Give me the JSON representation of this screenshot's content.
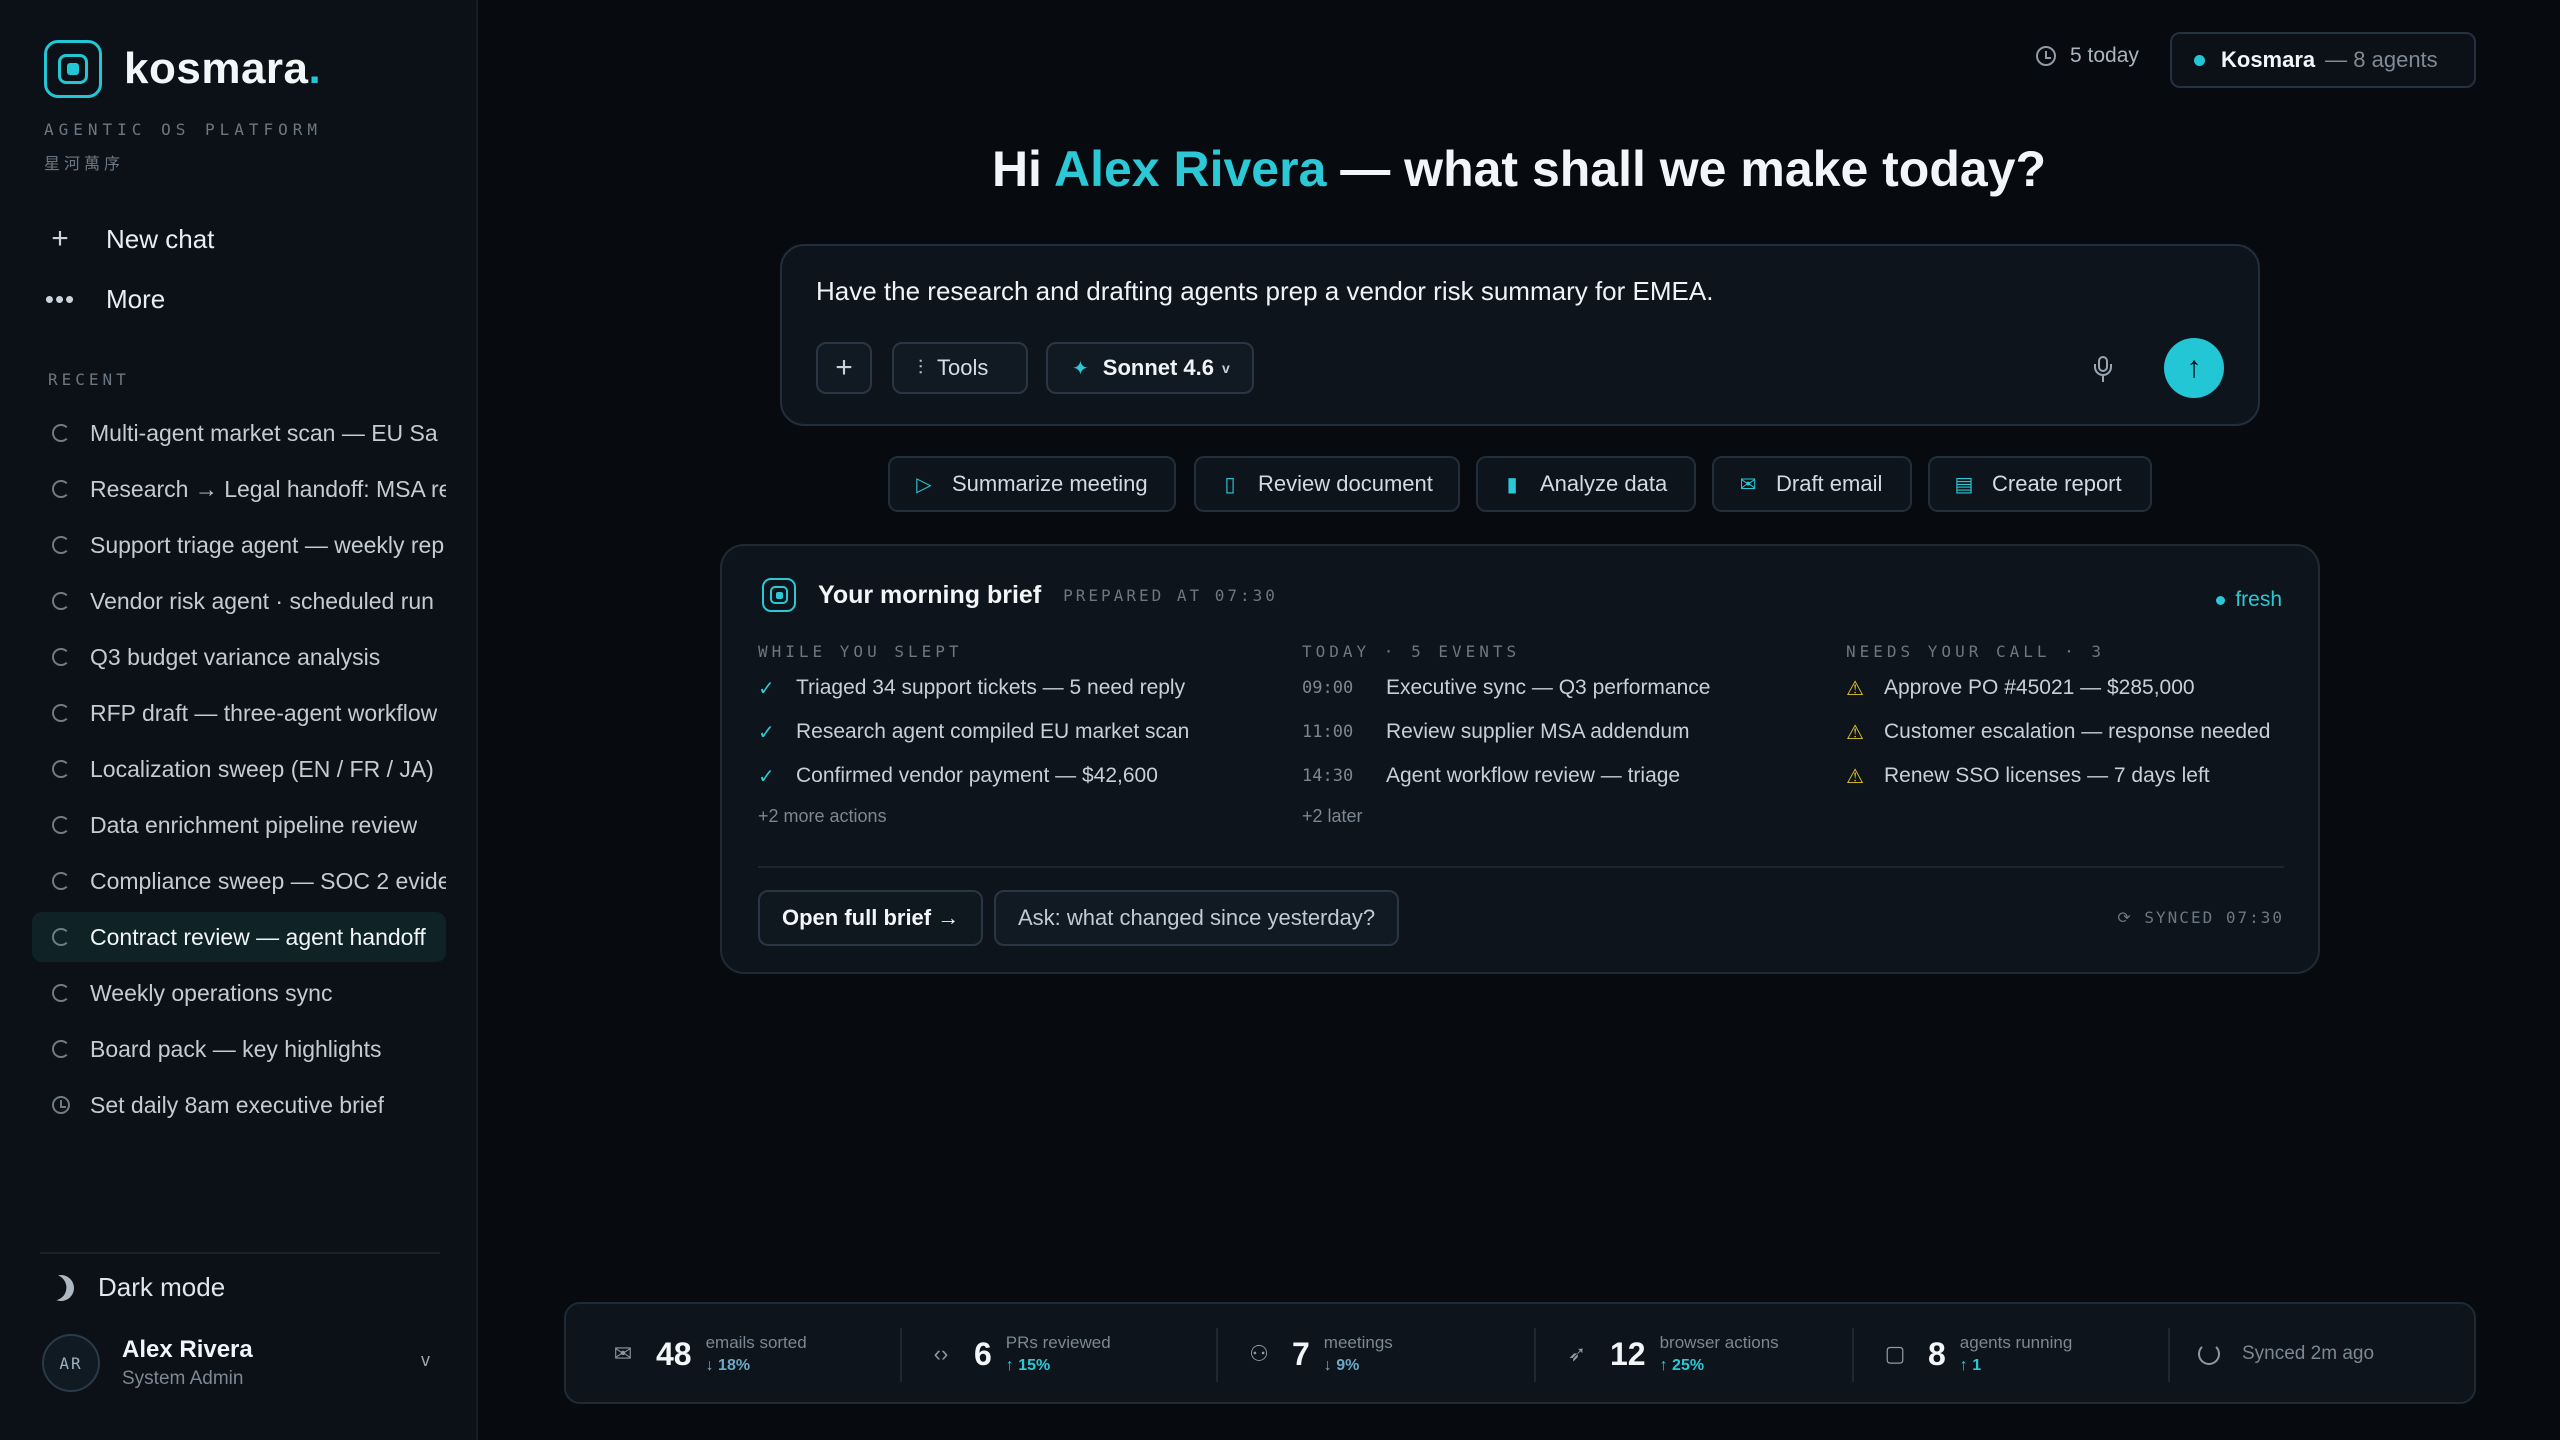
{
  "sidebar": {
    "logo_text": "kosmara",
    "logo_accent": ".",
    "tagline": "AGENTIC OS PLATFORM",
    "tagline_cjk": "星河萬序",
    "new_chat": "New chat",
    "more": "More",
    "recent_label": "RECENT",
    "recent": [
      "Multi-agent market scan — EU Sa",
      "Research → Legal handoff: MSA re",
      "Support triage agent — weekly rep",
      "Vendor risk agent · scheduled run",
      "Q3 budget variance analysis",
      "RFP draft — three-agent workflow",
      "Localization sweep (EN / FR / JA)",
      "Data enrichment pipeline review",
      "Compliance sweep — SOC 2 evide",
      "Contract review — agent handoff",
      "Weekly operations sync",
      "Board pack — key highlights",
      "Set daily 8am executive brief"
    ],
    "active_index": 9,
    "dark_mode": "Dark mode",
    "user": {
      "initials": "AR",
      "name": "Alex Rivera",
      "role": "System Admin",
      "caret": "v"
    }
  },
  "header": {
    "today": "5 today",
    "workspace": "Kosmara",
    "agents": "— 8 agents"
  },
  "greeting": {
    "hi": "Hi",
    "name": "Alex Rivera",
    "rest": "— what shall we make today?"
  },
  "composer": {
    "prompt": "Have the research and drafting agents prep a vendor risk summary for EMEA.",
    "plus": "+",
    "tools": "Tools",
    "model": "Sonnet 4.6",
    "model_caret": "v"
  },
  "quick_actions": [
    {
      "label": "Summarize meeting",
      "icon": "play-icon"
    },
    {
      "label": "Review document",
      "icon": "document-icon"
    },
    {
      "label": "Analyze data",
      "icon": "chart-icon"
    },
    {
      "label": "Draft email",
      "icon": "mail-icon"
    },
    {
      "label": "Create report",
      "icon": "report-icon"
    }
  ],
  "brief": {
    "title": "Your morning brief",
    "prepared": "PREPARED AT 07:30",
    "fresh": "fresh",
    "while_you_slept": {
      "heading": "WHILE YOU SLEPT",
      "items": [
        "Triaged 34 support tickets — 5 need reply",
        "Research agent compiled EU market scan",
        "Confirmed vendor payment — $42,600"
      ],
      "more": "+2 more actions"
    },
    "today": {
      "heading": "TODAY · 5 EVENTS",
      "items": [
        {
          "time": "09:00",
          "text": "Executive sync — Q3 performance"
        },
        {
          "time": "11:00",
          "text": "Review supplier MSA addendum"
        },
        {
          "time": "14:30",
          "text": "Agent workflow review — triage"
        }
      ],
      "more": "+2 later"
    },
    "needs_call": {
      "heading": "NEEDS YOUR CALL · 3",
      "items": [
        "Approve PO #45021 — $285,000",
        "Customer escalation — response needed",
        "Renew SSO licenses — 7 days left"
      ]
    },
    "open_full": "Open full brief →",
    "ask": "Ask: what changed since yesterday?",
    "synced": "SYNCED 07:30"
  },
  "stats": [
    {
      "icon": "mail-icon",
      "value": "48",
      "label": "emails sorted",
      "delta": "↓ 18%"
    },
    {
      "icon": "code-icon",
      "value": "6",
      "label": "PRs reviewed",
      "delta": "↑ 15%"
    },
    {
      "icon": "people-icon",
      "value": "7",
      "label": "meetings",
      "delta": "↓ 9%"
    },
    {
      "icon": "cursor-icon",
      "value": "12",
      "label": "browser actions",
      "delta": "↑ 25%"
    },
    {
      "icon": "bot-icon",
      "value": "8",
      "label": "agents running",
      "delta": "↑ 1"
    }
  ],
  "synced_status": "Synced 2m ago",
  "colors": {
    "accent": "#22c6d4",
    "warning": "#e3c62c",
    "background": "#070b10"
  }
}
